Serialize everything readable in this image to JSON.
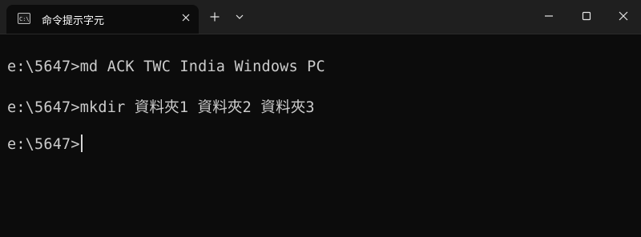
{
  "tab": {
    "title": "命令提示字元",
    "icon": "cmd-icon"
  },
  "titlebar": {
    "new_tab_icon": "plus-icon",
    "dropdown_icon": "chevron-down-icon",
    "minimize_icon": "minimize-icon",
    "maximize_icon": "maximize-icon",
    "close_icon": "close-icon"
  },
  "terminal": {
    "lines": [
      {
        "prompt": "e:\\5647>",
        "command": "md ACK TWC India Windows PC"
      },
      {
        "prompt": "e:\\5647>",
        "command": "mkdir 資料夾1 資料夾2 資料夾3"
      },
      {
        "prompt": "e:\\5647>",
        "command": ""
      }
    ],
    "colors": {
      "background": "#0c0c0c",
      "text": "#cccccc",
      "titlebar": "#1f1f1f"
    }
  }
}
